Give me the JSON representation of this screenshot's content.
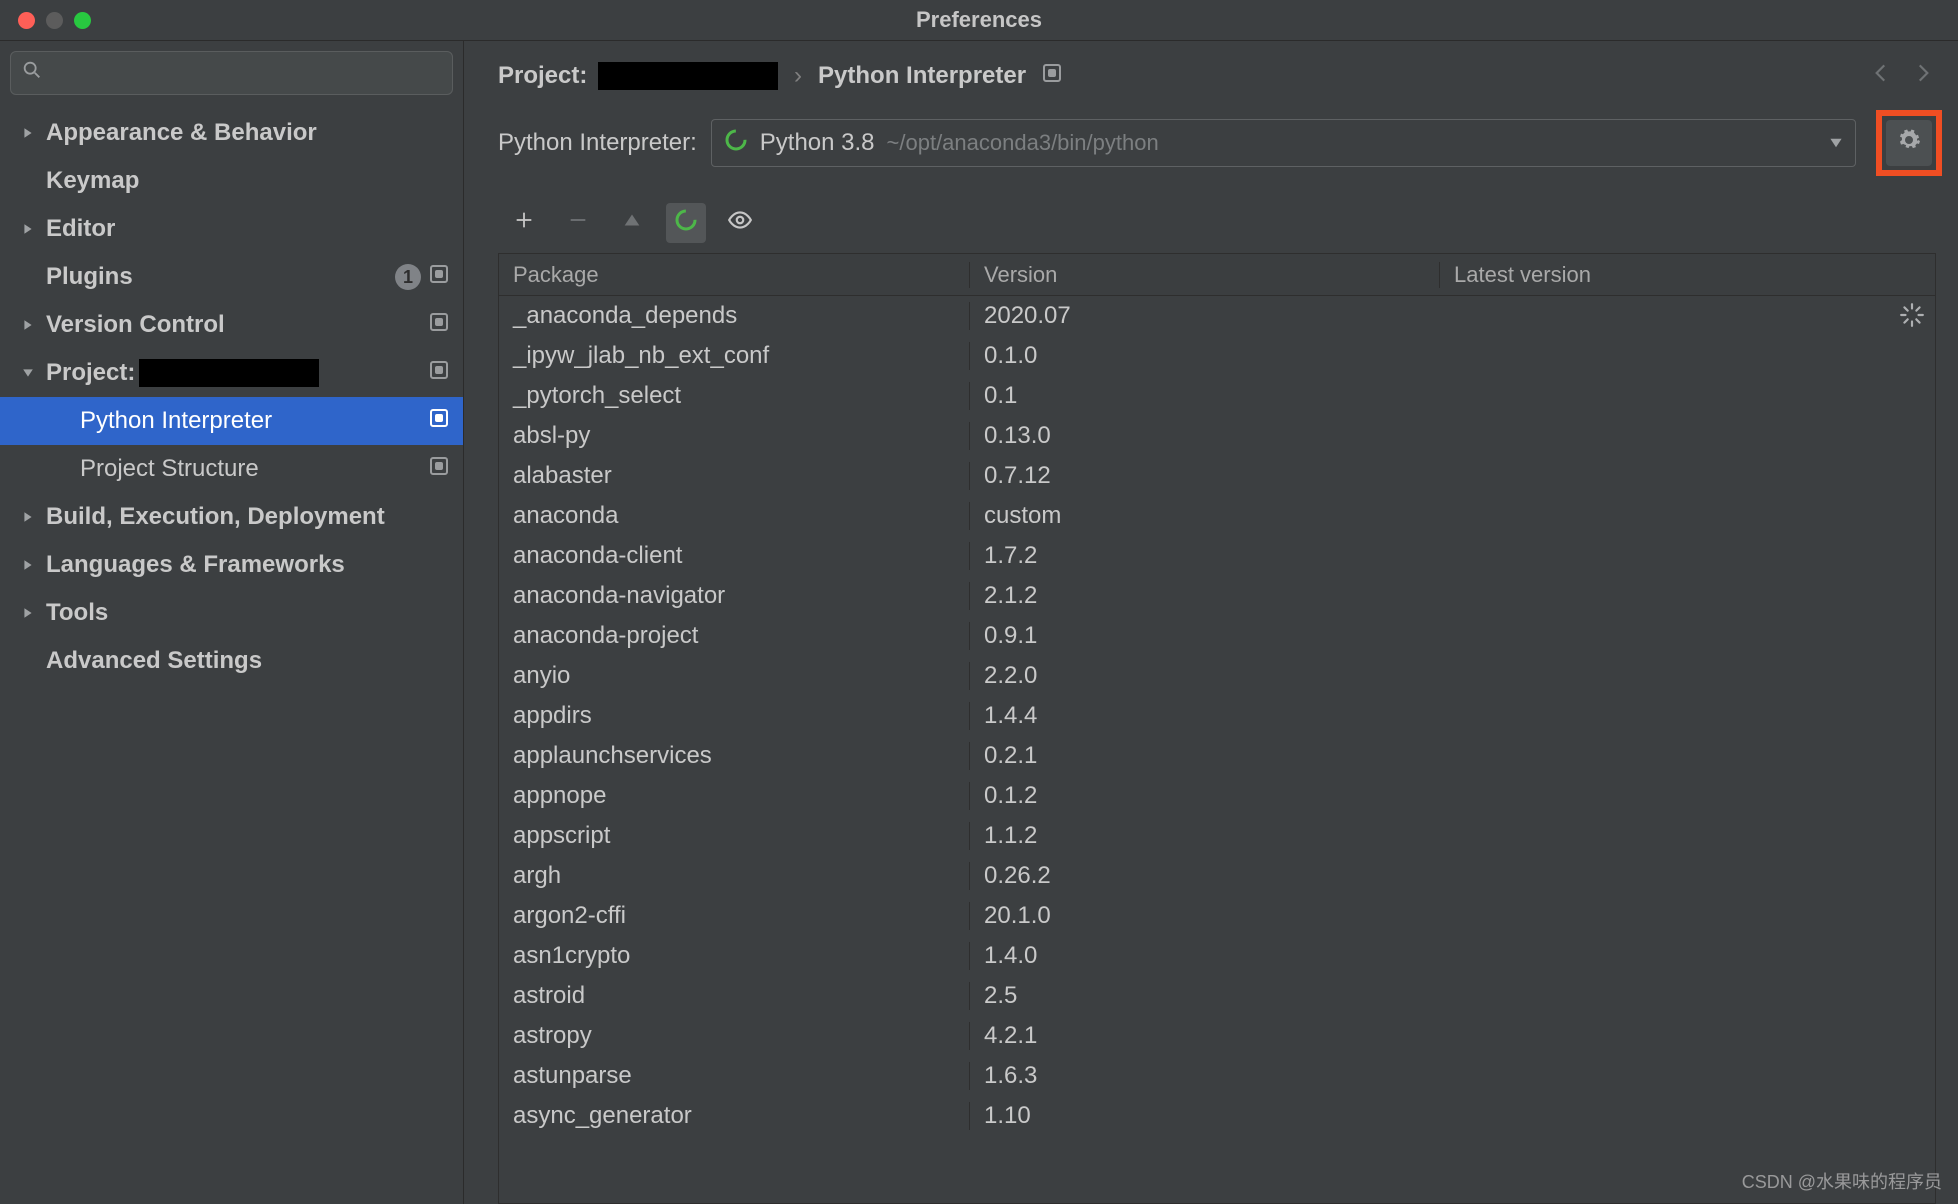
{
  "window": {
    "title": "Preferences"
  },
  "search": {
    "placeholder": ""
  },
  "sidebar": {
    "items": [
      {
        "label": "Appearance & Behavior",
        "expandable": true
      },
      {
        "label": "Keymap",
        "expandable": false
      },
      {
        "label": "Editor",
        "expandable": true
      },
      {
        "label": "Plugins",
        "expandable": false,
        "count": "1",
        "actions": true
      },
      {
        "label": "Version Control",
        "expandable": true,
        "actions": true
      },
      {
        "label": "Project:",
        "expandable": true,
        "expanded": true,
        "actions": true,
        "redacted": true
      },
      {
        "label": "Build, Execution, Deployment",
        "expandable": true
      },
      {
        "label": "Languages & Frameworks",
        "expandable": true
      },
      {
        "label": "Tools",
        "expandable": true
      },
      {
        "label": "Advanced Settings",
        "expandable": false
      }
    ],
    "children": [
      {
        "label": "Python Interpreter",
        "selected": true,
        "actions": true
      },
      {
        "label": "Project Structure",
        "selected": false,
        "actions": true
      }
    ]
  },
  "breadcrumb": {
    "project_label": "Project:",
    "separator": "›",
    "current": "Python Interpreter"
  },
  "interpreter": {
    "label": "Python Interpreter:",
    "name": "Python 3.8",
    "path": "~/opt/anaconda3/bin/python"
  },
  "table": {
    "headers": {
      "package": "Package",
      "version": "Version",
      "latest": "Latest version"
    },
    "rows": [
      {
        "pkg": "_anaconda_depends",
        "ver": "2020.07"
      },
      {
        "pkg": "_ipyw_jlab_nb_ext_conf",
        "ver": "0.1.0"
      },
      {
        "pkg": "_pytorch_select",
        "ver": "0.1"
      },
      {
        "pkg": "absl-py",
        "ver": "0.13.0"
      },
      {
        "pkg": "alabaster",
        "ver": "0.7.12"
      },
      {
        "pkg": "anaconda",
        "ver": "custom"
      },
      {
        "pkg": "anaconda-client",
        "ver": "1.7.2"
      },
      {
        "pkg": "anaconda-navigator",
        "ver": "2.1.2"
      },
      {
        "pkg": "anaconda-project",
        "ver": "0.9.1"
      },
      {
        "pkg": "anyio",
        "ver": "2.2.0"
      },
      {
        "pkg": "appdirs",
        "ver": "1.4.4"
      },
      {
        "pkg": "applaunchservices",
        "ver": "0.2.1"
      },
      {
        "pkg": "appnope",
        "ver": "0.1.2"
      },
      {
        "pkg": "appscript",
        "ver": "1.1.2"
      },
      {
        "pkg": "argh",
        "ver": "0.26.2"
      },
      {
        "pkg": "argon2-cffi",
        "ver": "20.1.0"
      },
      {
        "pkg": "asn1crypto",
        "ver": "1.4.0"
      },
      {
        "pkg": "astroid",
        "ver": "2.5"
      },
      {
        "pkg": "astropy",
        "ver": "4.2.1"
      },
      {
        "pkg": "astunparse",
        "ver": "1.6.3"
      },
      {
        "pkg": "async_generator",
        "ver": "1.10"
      }
    ]
  },
  "watermark": "CSDN @水果味的程序员"
}
